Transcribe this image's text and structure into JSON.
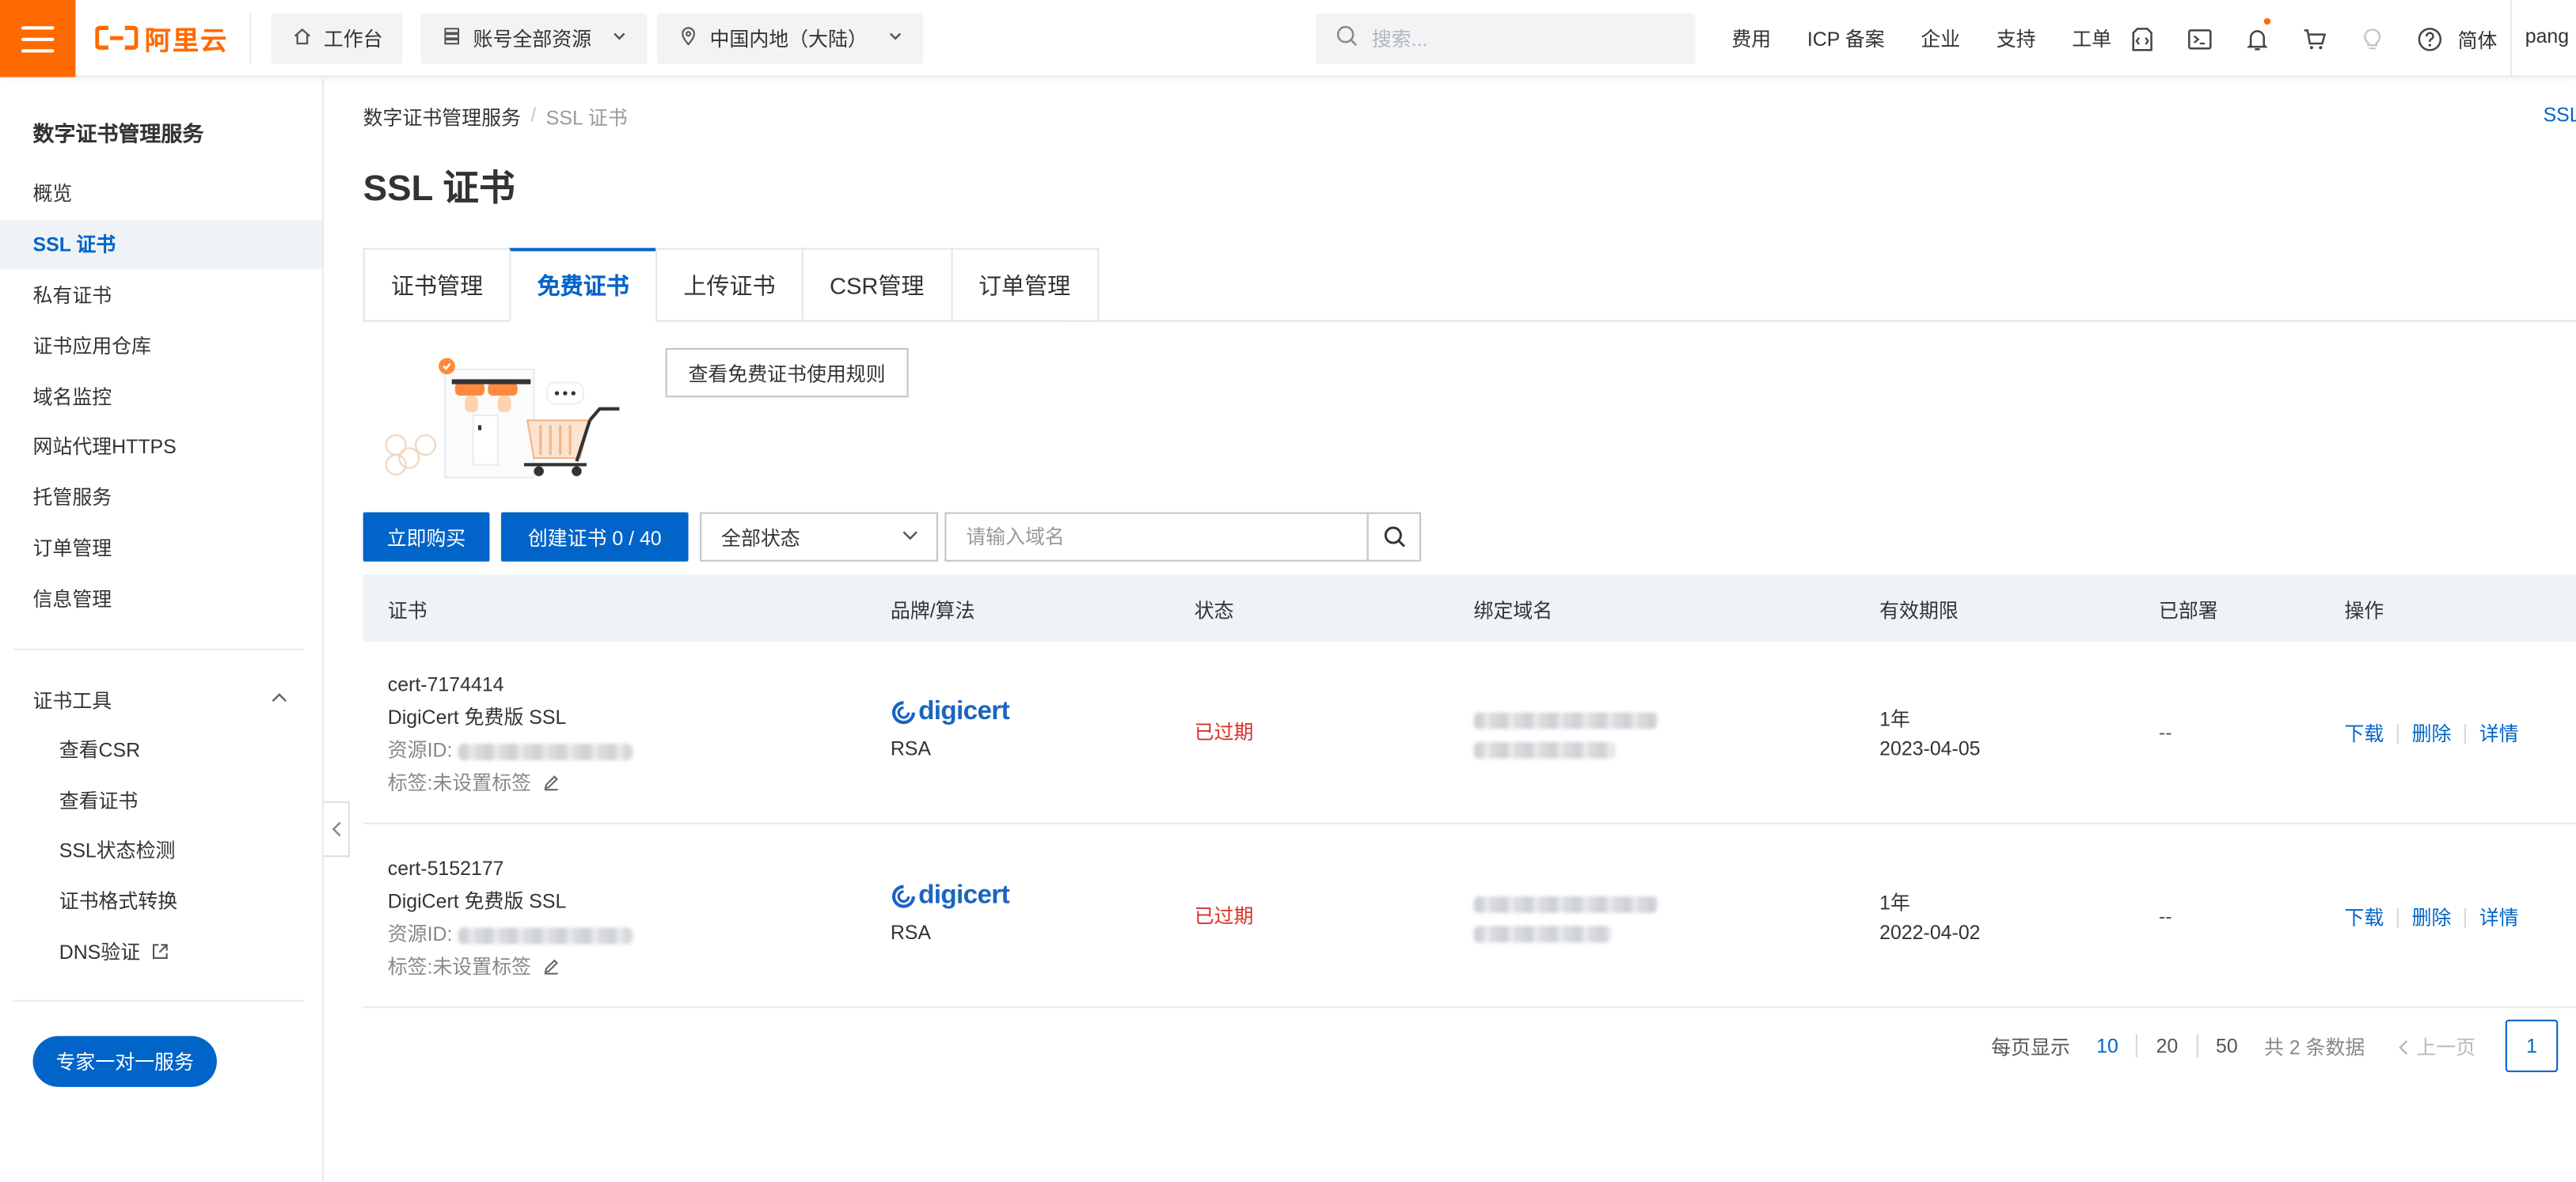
{
  "topbar": {
    "logo_text": "阿里云",
    "workbench": "工作台",
    "resource_scope": "账号全部资源",
    "region": "中国内地（大陆）",
    "search_placeholder": "搜索...",
    "links": [
      "费用",
      "ICP 备案",
      "企业",
      "支持",
      "工单"
    ],
    "icons": [
      "code-icon",
      "terminal-icon",
      "bell-icon",
      "cart-icon",
      "lightbulb-icon",
      "help-icon"
    ],
    "language": "简体",
    "user": "pang"
  },
  "sidebar": {
    "title": "数字证书管理服务",
    "items": [
      {
        "label": "概览"
      },
      {
        "label": "SSL 证书",
        "active": true
      },
      {
        "label": "私有证书"
      },
      {
        "label": "证书应用仓库"
      },
      {
        "label": "域名监控"
      },
      {
        "label": "网站代理HTTPS"
      },
      {
        "label": "托管服务"
      },
      {
        "label": "订单管理"
      },
      {
        "label": "信息管理"
      }
    ],
    "tools_group": "证书工具",
    "tools": [
      {
        "label": "查看CSR"
      },
      {
        "label": "查看证书"
      },
      {
        "label": "SSL状态检测"
      },
      {
        "label": "证书格式转换"
      },
      {
        "label": "DNS验证"
      }
    ],
    "expert_button": "专家一对一服务"
  },
  "breadcrumb": {
    "root": "数字证书管理服务",
    "separator": "/",
    "current": "SSL 证书"
  },
  "corner_link": "SSL",
  "page_title": "SSL 证书",
  "tabs": [
    {
      "label": "证书管理"
    },
    {
      "label": "免费证书",
      "active": true
    },
    {
      "label": "上传证书"
    },
    {
      "label": "CSR管理"
    },
    {
      "label": "订单管理"
    }
  ],
  "rules_button": "查看免费证书使用规则",
  "toolbar": {
    "buy_button": "立即购买",
    "create_button": "创建证书 0 / 40",
    "status_select": "全部状态",
    "domain_placeholder": "请输入域名"
  },
  "table": {
    "columns": [
      "证书",
      "品牌/算法",
      "状态",
      "绑定域名",
      "有效期限",
      "已部署",
      "操作"
    ],
    "rows": [
      {
        "name": "cert-7174414",
        "product": "DigiCert 免费版 SSL",
        "resource_label": "资源ID:",
        "tag_label": "标签:未设置标签",
        "brand": "digicert",
        "algorithm": "RSA",
        "status": "已过期",
        "validity": "1年",
        "expire_date": "2023-04-05",
        "deployed": "--",
        "actions": [
          "下载",
          "删除",
          "详情"
        ]
      },
      {
        "name": "cert-5152177",
        "product": "DigiCert 免费版 SSL",
        "resource_label": "资源ID:",
        "tag_label": "标签:未设置标签",
        "brand": "digicert",
        "algorithm": "RSA",
        "status": "已过期",
        "validity": "1年",
        "expire_date": "2022-04-02",
        "deployed": "--",
        "actions": [
          "下载",
          "删除",
          "详情"
        ]
      }
    ]
  },
  "pagination": {
    "per_page_label": "每页显示",
    "sizes": [
      "10",
      "20",
      "50"
    ],
    "selected_size": "10",
    "total_text": "共 2 条数据",
    "prev_label": "上一页",
    "current_page": "1"
  },
  "colors": {
    "brand_orange": "#ff6a00",
    "primary_blue": "#0064c8",
    "expired_red": "#d93026",
    "table_header_bg": "#eff3f8"
  }
}
